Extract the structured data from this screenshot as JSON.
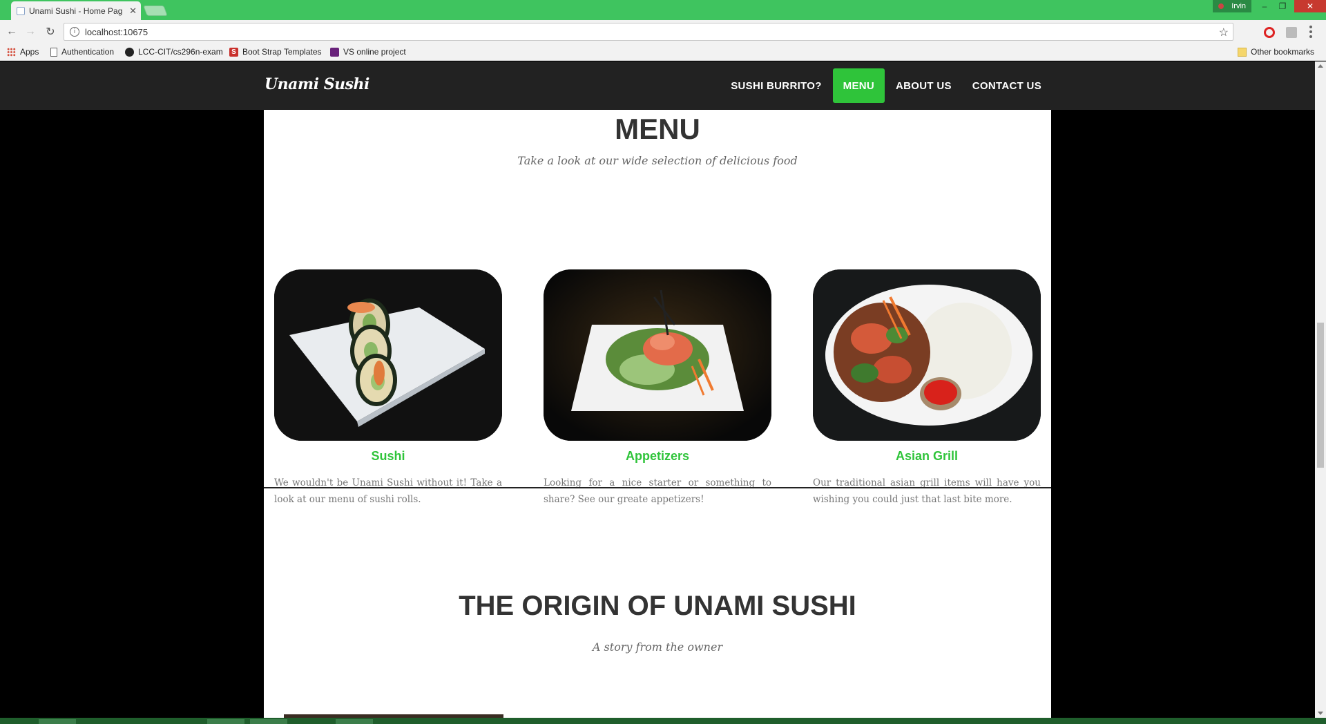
{
  "browser": {
    "tab_title": "Unami Sushi - Home Pag",
    "profile_name": "Irvin",
    "url": "localhost:10675",
    "bookmarks": [
      "Apps",
      "Authentication",
      "LCC-CIT/cs296n-exam",
      "Boot Strap Templates",
      "VS online project"
    ],
    "other_bookmarks": "Other bookmarks"
  },
  "nav": {
    "brand": "Unami Sushi",
    "links": [
      "SUSHI BURRITO?",
      "MENU",
      "ABOUT US",
      "CONTACT US"
    ],
    "active_link": "MENU",
    "accent_color": "#2fc43a"
  },
  "menu_section": {
    "title": "MENU",
    "subtitle": "Take a look at our wide selection of delicious food",
    "items": [
      {
        "title": "Sushi",
        "text": "We wouldn't be Unami Sushi without it! Take a look at our menu of sushi rolls."
      },
      {
        "title": "Appetizers",
        "text": "Looking for a nice starter or something to share? See our greate appetizers!"
      },
      {
        "title": "Asian Grill",
        "text": "Our traditional asian grill items will have you wishing you could just that last bite more."
      }
    ]
  },
  "origin_section": {
    "title": "THE ORIGIN OF UNAMI SUSHI",
    "subtitle": "A story from the owner"
  }
}
